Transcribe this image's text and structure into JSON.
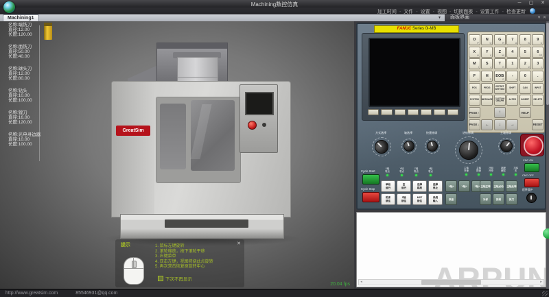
{
  "window": {
    "title": "Machining数控仿真",
    "controls": {
      "minimize": "─",
      "maximize": "▢",
      "close": "✕"
    }
  },
  "menu": {
    "items": [
      "加工时间",
      "文件",
      "设置",
      "视图",
      "切换面板",
      "设置工件",
      "检查更新"
    ]
  },
  "tab": {
    "label": "Machining1"
  },
  "panel_window": {
    "header": "面板界面",
    "restore_icon": "▾",
    "close_icon": "✕"
  },
  "tool_list": [
    {
      "name": "名称:端铣刀",
      "dia": "直径:12.00",
      "len": "长度:120.00",
      "selected": true
    },
    {
      "name": "名称:面铣刀",
      "dia": "直径:50.00",
      "len": "长度:40.00"
    },
    {
      "name": "名称:球头刀",
      "dia": "直径:12.00",
      "len": "长度:80.00"
    },
    {
      "name": "名称:钻头",
      "dia": "直径:10.00",
      "len": "长度:100.00"
    },
    {
      "name": "名称:镗刀",
      "dia": "直径:16.00",
      "len": "长度:120.00"
    },
    {
      "name": "名称:光电寻边器",
      "dia": "直径:10.00",
      "len": "长度:100.00"
    }
  ],
  "machine": {
    "brand_label": "GreatSim"
  },
  "hint_box": {
    "title": "提示",
    "close": "✕",
    "lines": [
      "1. 鼠标左键旋转",
      "2. 滚轮缩放，按下滚轮平移",
      "3. 右键菜单",
      "4. 双击左键，视图将绕此点旋转",
      "5. 再次双击恢复原旋转中心"
    ],
    "dont_show": "下次不再显示"
  },
  "viewport": {
    "fps": "20.04 fps"
  },
  "fanuc": {
    "brand": "FANUC",
    "series": " Series 0i-MB",
    "address_keys": [
      {
        "m": "O",
        "s": "P"
      },
      {
        "m": "N",
        "s": "Q"
      },
      {
        "m": "G",
        "s": "R"
      },
      {
        "m": "7",
        "s": "A"
      },
      {
        "m": "8",
        "s": "B"
      },
      {
        "m": "9",
        "s": "C"
      },
      {
        "m": "X",
        "s": "U"
      },
      {
        "m": "Y",
        "s": "V"
      },
      {
        "m": "Z",
        "s": "W"
      },
      {
        "m": "4",
        "s": ""
      },
      {
        "m": "5",
        "s": ""
      },
      {
        "m": "6",
        "s": "SP"
      },
      {
        "m": "M",
        "s": "I"
      },
      {
        "m": "S",
        "s": "J"
      },
      {
        "m": "T",
        "s": "K"
      },
      {
        "m": "1",
        "s": ","
      },
      {
        "m": "2",
        "s": "#"
      },
      {
        "m": "3",
        "s": "="
      },
      {
        "m": "F",
        "s": "L"
      },
      {
        "m": "H",
        "s": "D"
      },
      {
        "m": "EOB",
        "s": "E"
      },
      {
        "m": "-",
        "s": "+"
      },
      {
        "m": "0",
        "s": ""
      },
      {
        "m": ".",
        "s": "/"
      }
    ],
    "function_keys": [
      "POS",
      "PROG",
      "OFFSET SETTING",
      "SHIFT",
      "CAN",
      "INPUT",
      "SYSTEM",
      "MESSAGE",
      "CUSTOM GRAPH",
      "ALTER",
      "INSERT",
      "DELETE"
    ],
    "nav": {
      "page_up": "PAGE ↑",
      "page_down": "PAGE ↓",
      "up": "↑",
      "left": "←",
      "down": "↓",
      "right": "→",
      "help": "HELP",
      "reset": "RESET"
    },
    "knobs": [
      {
        "label": "方式选择"
      },
      {
        "label": "轴选择"
      },
      {
        "label": "快速修调"
      },
      {
        "label": "进给修调"
      },
      {
        "label": "主轴修调"
      }
    ],
    "cycle": {
      "start": "Cycle Start",
      "stop": "Cycle Stop"
    },
    "indicators": [
      [
        "X轴",
        "零点"
      ],
      [
        "Y轴",
        "零点"
      ],
      [
        "Z轴",
        "零点"
      ],
      [
        "4轴",
        "零点"
      ]
    ],
    "white_buttons": [
      [
        "单段",
        "运行"
      ],
      [
        "空",
        "运行"
      ],
      [
        "选择",
        "跳段"
      ],
      [
        "选择",
        "停止"
      ],
      [
        "机床",
        "锁住"
      ],
      [
        "Z轴",
        "锁住"
      ],
      [
        "MST",
        "锁住"
      ],
      [
        "系统",
        "输入"
      ]
    ],
    "led_labels": [
      [
        "主轴",
        "升速"
      ],
      [
        "主轴",
        "降速"
      ],
      [
        "冷却",
        "开停"
      ],
      [
        "超程",
        "解除"
      ],
      [
        "刀库",
        "关"
      ]
    ],
    "jog_buttons": [
      "X轴+",
      "Y轴+",
      "Z轴+",
      "快速"
    ],
    "aux_buttons": [
      "主轴正转",
      "主轴点动",
      "主轴反转",
      "冷却",
      "排屑",
      "换刀"
    ],
    "power": {
      "cnc_on": "CNC ON",
      "cnc_off": "CNC OFF",
      "protect": "程序保护"
    }
  },
  "program_area": {
    "watermark": "ARPUN"
  },
  "status_bar": {
    "website": "http://www.greatsim.com",
    "email": "85546931@qq.com"
  },
  "colors": {
    "fanuc_label_bg": "#e8e000",
    "fanuc_brand_red": "#cc1100",
    "hint_green": "#a6bf27",
    "fps_green": "#3fae3f",
    "estop_red": "#c41425",
    "cycle_start_green": "#1e9e2e",
    "cycle_stop_red": "#cc2222"
  }
}
